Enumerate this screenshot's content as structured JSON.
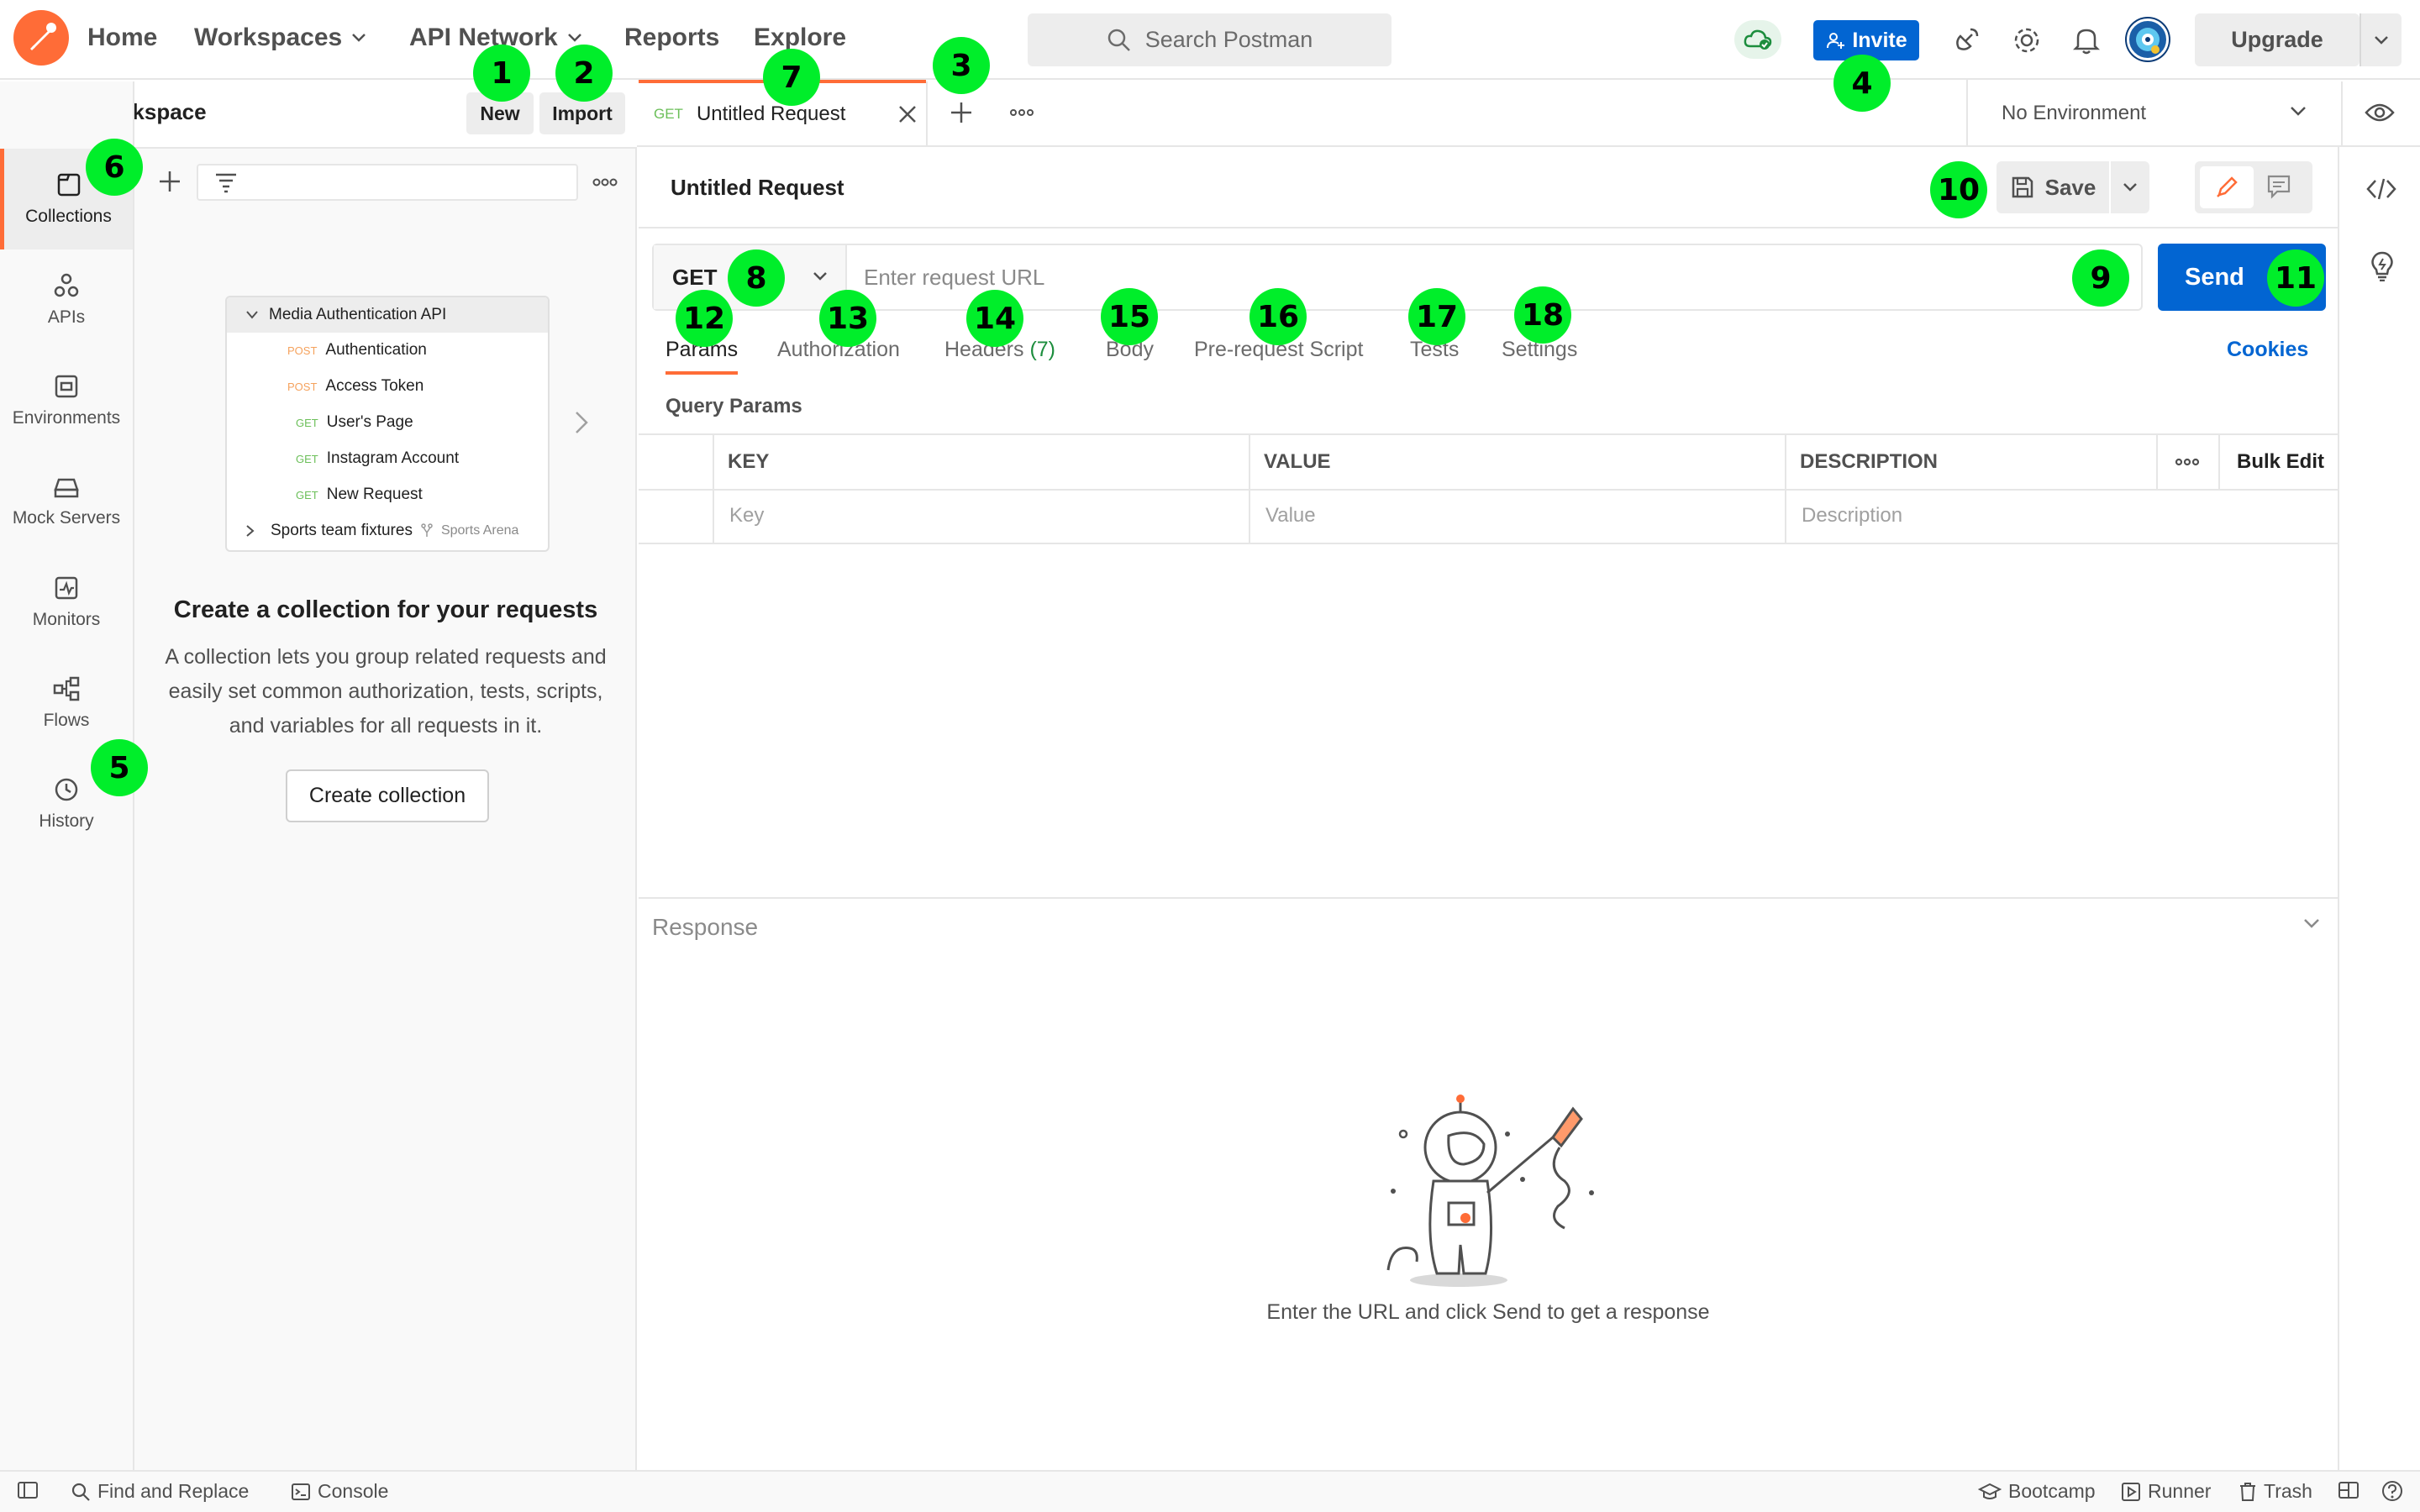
{
  "topnav": {
    "items": [
      "Home",
      "Workspaces",
      "API Network",
      "Reports",
      "Explore"
    ],
    "search_placeholder": "Search Postman",
    "invite_label": "Invite",
    "upgrade_label": "Upgrade"
  },
  "workspace": {
    "name": "My Workspace",
    "new_label": "New",
    "import_label": "Import"
  },
  "rail": [
    {
      "label": "Collections",
      "icon": "collections-icon"
    },
    {
      "label": "APIs",
      "icon": "apis-icon"
    },
    {
      "label": "Environments",
      "icon": "environments-icon"
    },
    {
      "label": "Mock Servers",
      "icon": "mock-servers-icon"
    },
    {
      "label": "Monitors",
      "icon": "monitors-icon"
    },
    {
      "label": "Flows",
      "icon": "flows-icon"
    },
    {
      "label": "History",
      "icon": "history-icon"
    }
  ],
  "preview": {
    "collection": "Media Authentication API",
    "requests": [
      {
        "method": "POST",
        "name": "Authentication"
      },
      {
        "method": "POST",
        "name": "Access Token"
      },
      {
        "method": "GET",
        "name": "User's Page"
      },
      {
        "method": "GET",
        "name": "Instagram Account"
      },
      {
        "method": "GET",
        "name": "New Request"
      }
    ],
    "second_collection": "Sports team fixtures",
    "fork_label": "Sports Arena"
  },
  "empty_state": {
    "title": "Create a collection for your requests",
    "desc_lines": [
      "A collection lets you group related requests and",
      "easily set common authorization, tests, scripts,",
      "and variables for all requests in it."
    ],
    "button": "Create collection"
  },
  "tab": {
    "method": "GET",
    "title": "Untitled Request"
  },
  "environment": {
    "selected": "No Environment"
  },
  "request": {
    "title": "Untitled Request",
    "save_label": "Save",
    "method": "GET",
    "url_placeholder": "Enter request URL",
    "send_label": "Send",
    "tabs": [
      "Params",
      "Authorization",
      "Headers",
      "Body",
      "Pre-request Script",
      "Tests",
      "Settings"
    ],
    "headers_count": "(7)",
    "cookies_label": "Cookies",
    "query_params_title": "Query Params",
    "columns": [
      "KEY",
      "VALUE",
      "DESCRIPTION"
    ],
    "bulk_edit": "Bulk Edit",
    "placeholders": {
      "key": "Key",
      "value": "Value",
      "description": "Description"
    }
  },
  "response": {
    "title": "Response",
    "hint": "Enter the URL and click Send to get a response"
  },
  "footer": {
    "find_replace": "Find and Replace",
    "console": "Console",
    "bootcamp": "Bootcamp",
    "runner": "Runner",
    "trash": "Trash"
  },
  "markers": [
    "1",
    "2",
    "3",
    "4",
    "5",
    "6",
    "7",
    "8",
    "9",
    "10",
    "11",
    "12",
    "13",
    "14",
    "15",
    "16",
    "17",
    "18"
  ],
  "colors": {
    "accent": "#ff6c37",
    "primary": "#0265d2",
    "marker": "#00ee2a"
  }
}
